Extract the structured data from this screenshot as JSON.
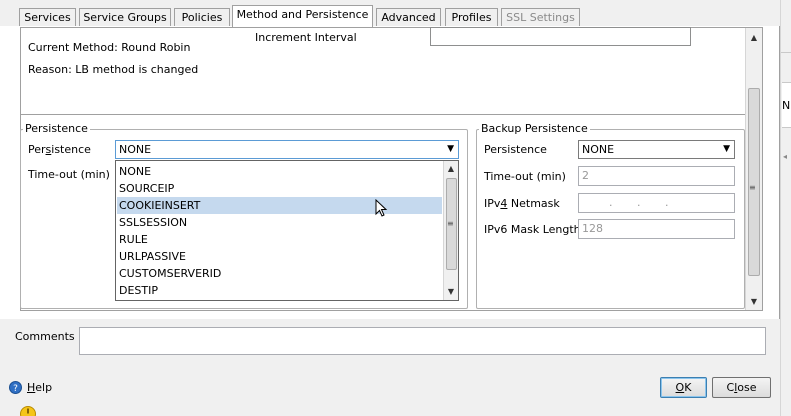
{
  "tabs": [
    {
      "label": "Services"
    },
    {
      "label": "Service Groups"
    },
    {
      "label": "Policies"
    },
    {
      "label": "Method and Persistence"
    },
    {
      "label": "Advanced"
    },
    {
      "label": "Profiles"
    },
    {
      "label": "SSL Settings"
    }
  ],
  "method": {
    "increment_label": "Increment Interval",
    "increment_value": "",
    "current": "Current Method: Round Robin",
    "reason": "Reason: LB method is changed"
  },
  "persistence": {
    "legend": "Persistence",
    "persistence_label_a": "Per",
    "persistence_label_key": "s",
    "persistence_label_b": "istence",
    "selected": "NONE",
    "timeout_label": "Time-out (min)",
    "options": [
      "NONE",
      "SOURCEIP",
      "COOKIEINSERT",
      "SSLSESSION",
      "RULE",
      "URLPASSIVE",
      "CUSTOMSERVERID",
      "DESTIP"
    ],
    "highlighted": "COOKIEINSERT"
  },
  "backup": {
    "legend": "Backup Persistence",
    "persistence_label": "Persistence",
    "persistence_value": "NONE",
    "timeout_label": "Time-out (min)",
    "timeout_value": "2",
    "ipv4_label_a": "IPv",
    "ipv4_label_key": "4",
    "ipv4_label_b": " Netmask",
    "ipv4_value": ".       .       .",
    "ipv6_label": "IPv6 Mask Length",
    "ipv6_value": "128"
  },
  "comments": {
    "label": "Comments",
    "value": ""
  },
  "footer": {
    "help_key": "H",
    "help_rest": "elp",
    "ok_key": "O",
    "ok_rest": "K",
    "close_a": "C",
    "close_key": "l",
    "close_b": "ose"
  },
  "side": {
    "partial_text": "NE"
  }
}
